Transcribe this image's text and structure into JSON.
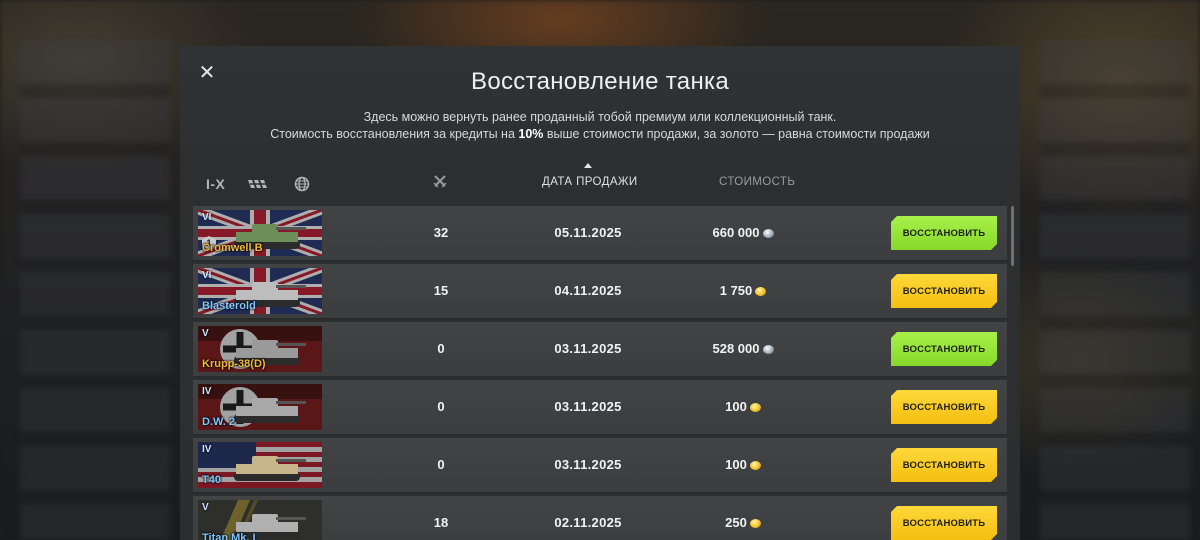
{
  "modal": {
    "close_icon": "✕",
    "title": "Восстановление танка",
    "desc_line1": "Здесь можно вернуть ранее проданный тобой премиум или коллекционный танк.",
    "desc_line2_pre": "Стоимость восстановления за кредиты на ",
    "desc_line2_bold": "10%",
    "desc_line2_post": " выше стоимости продажи, за золото — равна стоимости продажи"
  },
  "filters": {
    "tier_label": "I-X",
    "class_icon": "tank-class-icon",
    "nation_icon": "globe-icon"
  },
  "columns": {
    "battles_icon": "crossed-swords-icon",
    "date": "ДАТА ПРОДАЖИ",
    "cost": "СТОИМОСТЬ"
  },
  "colors": {
    "green_button": "#97e43a",
    "yellow_button": "#f8cc22",
    "gold_name": "#f1b93b",
    "blue_name": "#7ec6ff"
  },
  "rows": [
    {
      "tier": "VI",
      "name": "Cromwell B",
      "name_color": "gold",
      "battles": "32",
      "date": "05.11.2025",
      "cost": "660 000",
      "currency": "silver",
      "button": "ВОССТАНОВИТЬ",
      "button_color": "green",
      "flag": "uk",
      "mastery_badge": "1"
    },
    {
      "tier": "VI",
      "name": "Blasterold",
      "name_color": "blue",
      "battles": "15",
      "date": "04.11.2025",
      "cost": "1 750",
      "currency": "gold",
      "button": "ВОССТАНОВИТЬ",
      "button_color": "yellow",
      "flag": "uk"
    },
    {
      "tier": "V",
      "name": "Krupp-38(D)",
      "name_color": "gold",
      "battles": "0",
      "date": "03.11.2025",
      "cost": "528 000",
      "currency": "silver",
      "button": "ВОССТАНОВИТЬ",
      "button_color": "green",
      "flag": "germany"
    },
    {
      "tier": "IV",
      "name": "D.W. 2",
      "name_color": "blue",
      "battles": "0",
      "date": "03.11.2025",
      "cost": "100",
      "currency": "gold",
      "button": "ВОССТАНОВИТЬ",
      "button_color": "yellow",
      "flag": "germany"
    },
    {
      "tier": "IV",
      "name": "T40",
      "name_color": "blue",
      "battles": "0",
      "date": "03.11.2025",
      "cost": "100",
      "currency": "gold",
      "button": "ВОССТАНОВИТЬ",
      "button_color": "yellow",
      "flag": "usa"
    },
    {
      "tier": "V",
      "name": "Titan Mk. I",
      "name_color": "blue",
      "battles": "18",
      "date": "02.11.2025",
      "cost": "250",
      "currency": "gold",
      "button": "ВОССТАНОВИТЬ",
      "button_color": "yellow",
      "flag": "other"
    }
  ]
}
